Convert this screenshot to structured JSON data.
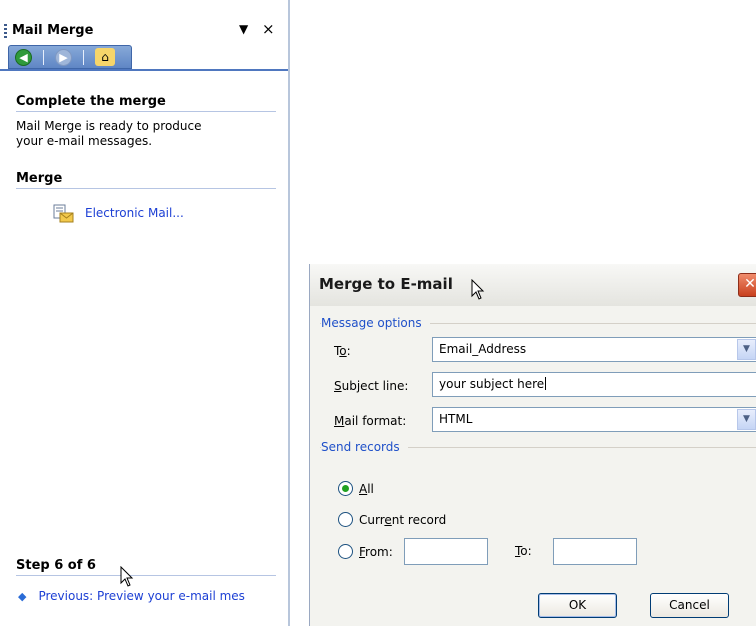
{
  "task_pane": {
    "title": "Mail Merge",
    "menu_glyph": "▼",
    "close_glyph": "×",
    "nav": {
      "back_glyph": "◀",
      "forward_glyph": "▶",
      "home_glyph": "⌂"
    },
    "complete_heading": "Complete the merge",
    "complete_desc_line1": "Mail Merge is ready to produce",
    "complete_desc_line2": "your e-mail messages.",
    "merge_heading": "Merge",
    "electronic_mail_link": "Electronic Mail...",
    "step_heading": "Step 6 of 6",
    "previous_link": "Previous: Preview your e-mail mes"
  },
  "dialog": {
    "title": "Merge to E-mail",
    "close_glyph": "✕",
    "message_options_label": "Message options",
    "to": {
      "label_pre": "T",
      "label_ul": "o",
      "label_post": ":",
      "value": "Email_Address"
    },
    "subject": {
      "label_ul": "S",
      "label_post": "ubject line:",
      "value": "your subject here"
    },
    "mail_format": {
      "label_ul": "M",
      "label_post": "ail format:",
      "value": "HTML"
    },
    "send_records_label": "Send records",
    "all": {
      "label_ul": "A",
      "label_post": "ll",
      "selected": true
    },
    "current": {
      "label_pre": "Curr",
      "label_ul": "e",
      "label_post": "nt record",
      "selected": false
    },
    "from": {
      "label_ul": "F",
      "label_post": "rom:",
      "value": "",
      "selected": false
    },
    "to_record": {
      "label_ul": "T",
      "label_post": "o:",
      "value": ""
    },
    "ok_label": "OK",
    "cancel_label": "Cancel",
    "dropdown_glyph": "▼"
  },
  "colors": {
    "link": "#1c3fd4",
    "group_label": "#1f50c9",
    "close_red": "#c8401e"
  }
}
